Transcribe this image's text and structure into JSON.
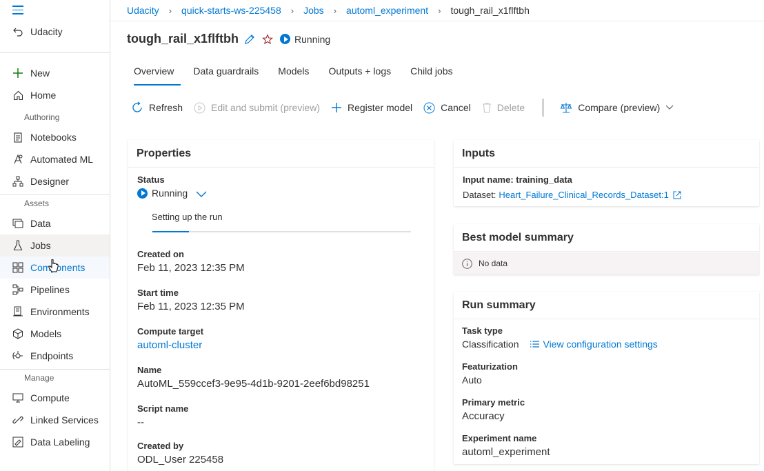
{
  "sidebar": {
    "home_org": "Udacity",
    "new": "New",
    "home": "Home",
    "section_authoring": "Authoring",
    "notebooks": "Notebooks",
    "automated_ml": "Automated ML",
    "designer": "Designer",
    "section_assets": "Assets",
    "data": "Data",
    "jobs": "Jobs",
    "components": "Components",
    "pipelines": "Pipelines",
    "environments": "Environments",
    "models": "Models",
    "endpoints": "Endpoints",
    "section_manage": "Manage",
    "compute": "Compute",
    "linked_services": "Linked Services",
    "data_labeling": "Data Labeling"
  },
  "breadcrumb": [
    "Udacity",
    "quick-starts-ws-225458",
    "Jobs",
    "automl_experiment",
    "tough_rail_x1flftbh"
  ],
  "header": {
    "title": "tough_rail_x1flftbh",
    "status": "Running"
  },
  "tabs": [
    "Overview",
    "Data guardrails",
    "Models",
    "Outputs + logs",
    "Child jobs"
  ],
  "toolbar": {
    "refresh": "Refresh",
    "edit_submit": "Edit and submit (preview)",
    "register_model": "Register model",
    "cancel": "Cancel",
    "delete": "Delete",
    "compare": "Compare (preview)"
  },
  "properties": {
    "heading": "Properties",
    "status_label": "Status",
    "status_value": "Running",
    "status_detail": "Setting up the run",
    "created_on_label": "Created on",
    "created_on_value": "Feb 11, 2023 12:35 PM",
    "start_time_label": "Start time",
    "start_time_value": "Feb 11, 2023 12:35 PM",
    "compute_label": "Compute target",
    "compute_value": "automl-cluster",
    "name_label": "Name",
    "name_value": "AutoML_559ccef3-9e95-4d1b-9201-2eef6bd98251",
    "script_label": "Script name",
    "script_value": "--",
    "created_by_label": "Created by",
    "created_by_value": "ODL_User 225458"
  },
  "inputs": {
    "heading": "Inputs",
    "input_name": "Input name: training_data",
    "dataset_label": "Dataset:",
    "dataset_link": "Heart_Failure_Clinical_Records_Dataset:1"
  },
  "best_model": {
    "heading": "Best model summary",
    "empty": "No data"
  },
  "run_summary": {
    "heading": "Run summary",
    "task_label": "Task type",
    "task_value": "Classification",
    "view_config": "View configuration settings",
    "featurization_label": "Featurization",
    "featurization_value": "Auto",
    "metric_label": "Primary metric",
    "metric_value": "Accuracy",
    "experiment_label": "Experiment name",
    "experiment_value": "automl_experiment"
  },
  "colors": {
    "accent": "#0078d4",
    "text": "#323130",
    "muted": "#605e5c"
  }
}
